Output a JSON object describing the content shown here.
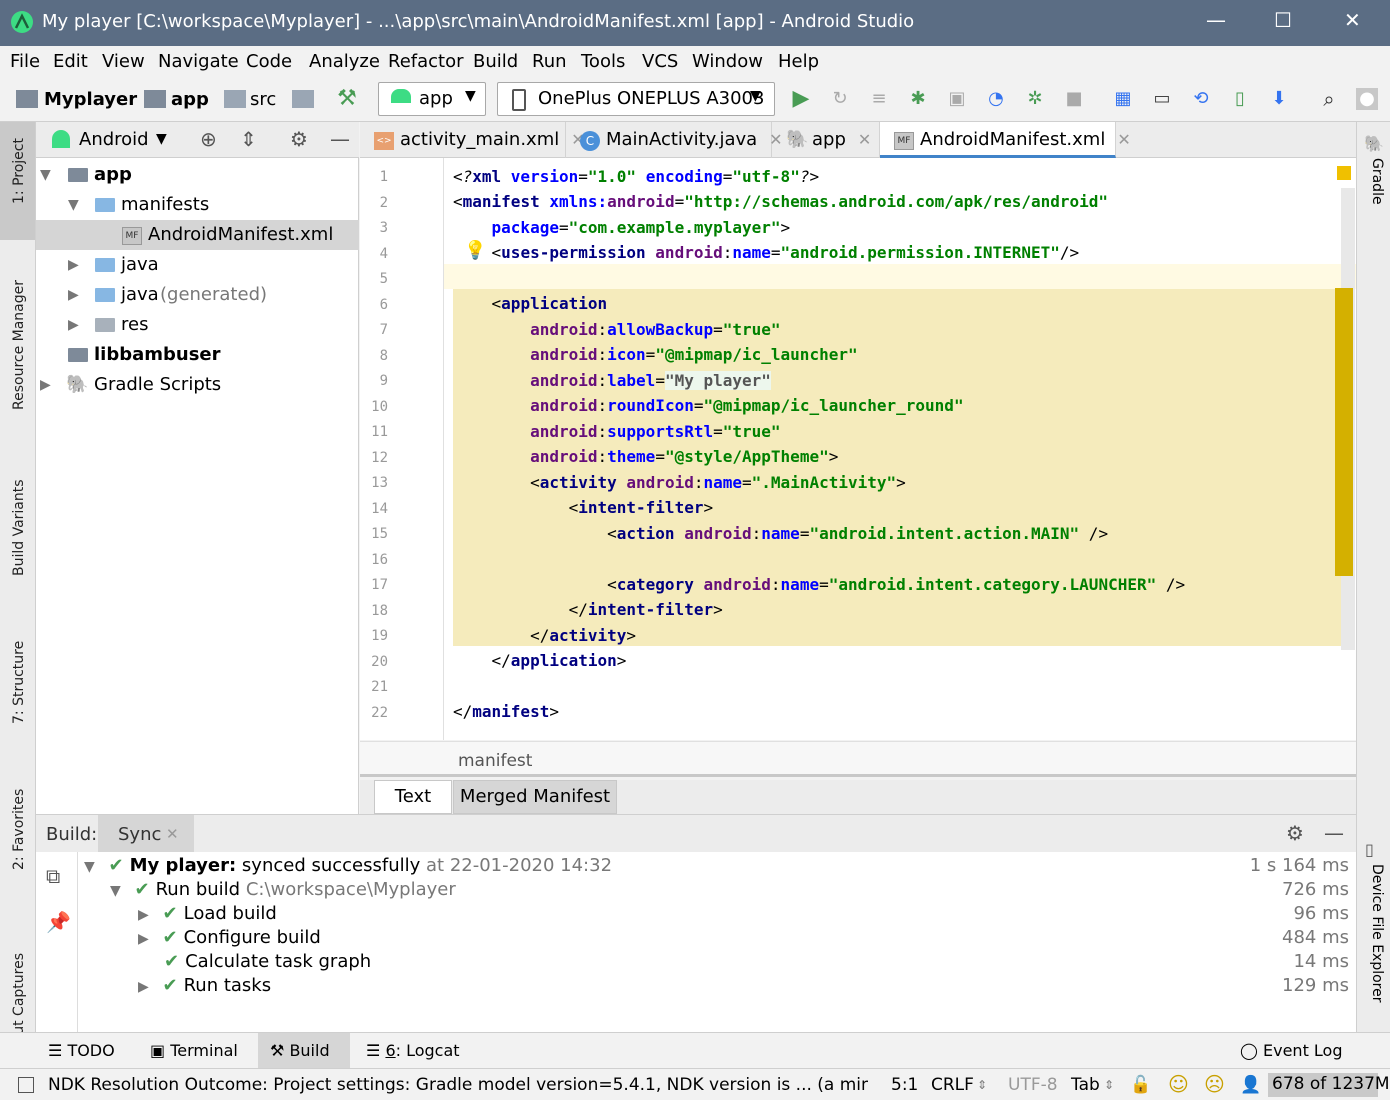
{
  "window": {
    "title": "My player [C:\\workspace\\Myplayer] - ...\\app\\src\\main\\AndroidManifest.xml [app] - Android Studio",
    "minimize": "—",
    "maximize": "☐",
    "close": "✕"
  },
  "menu": [
    "File",
    "Edit",
    "View",
    "Navigate",
    "Code",
    "Analyze",
    "Refactor",
    "Build",
    "Run",
    "Tools",
    "VCS",
    "Window",
    "Help"
  ],
  "toolbar": {
    "breadcrumb": [
      "Myplayer",
      "app",
      "src"
    ],
    "config": "app",
    "device": "OnePlus ONEPLUS A3003"
  },
  "left_tabs": [
    "1: Project",
    "Resource Manager",
    "Build Variants",
    "7: Structure",
    "2: Favorites",
    "Layout Captures"
  ],
  "right_tabs": [
    "Gradle",
    "Device File Explorer"
  ],
  "project": {
    "view": "Android",
    "tree": [
      {
        "label": "app",
        "bold": true
      },
      {
        "label": "manifests"
      },
      {
        "label": "AndroidManifest.xml"
      },
      {
        "label": "java"
      },
      {
        "label": "java",
        "suffix": "(generated)"
      },
      {
        "label": "res"
      },
      {
        "label": "libbambuser",
        "bold": true
      },
      {
        "label": "Gradle Scripts"
      }
    ]
  },
  "editor_tabs": [
    {
      "label": "activity_main.xml"
    },
    {
      "label": "MainActivity.java"
    },
    {
      "label": "app"
    },
    {
      "label": "AndroidManifest.xml",
      "active": true
    }
  ],
  "line_numbers": [
    "1",
    "2",
    "3",
    "4",
    "5",
    "6",
    "7",
    "8",
    "9",
    "10",
    "11",
    "12",
    "13",
    "14",
    "15",
    "16",
    "17",
    "18",
    "19",
    "20",
    "21",
    "22"
  ],
  "breadcrumb_bottom": "manifest",
  "editor_bottom_tabs": [
    "Text",
    "Merged Manifest"
  ],
  "build": {
    "label": "Build:",
    "tab": "Sync",
    "rows": [
      {
        "bold": "My player:",
        "text": " synced successfully",
        "gray": " at 22-01-2020 14:32",
        "time": "1 s 164 ms"
      },
      {
        "bold": "",
        "text": "Run build",
        "gray": " C:\\workspace\\Myplayer",
        "time": "726 ms"
      },
      {
        "bold": "",
        "text": "Load build",
        "gray": "",
        "time": "96 ms"
      },
      {
        "bold": "",
        "text": "Configure build",
        "gray": "",
        "time": "484 ms"
      },
      {
        "bold": "",
        "text": "Calculate task graph",
        "gray": "",
        "time": "14 ms"
      },
      {
        "bold": "",
        "text": "Run tasks",
        "gray": "",
        "time": "129 ms"
      }
    ]
  },
  "tool_windows": {
    "todo": "TODO",
    "terminal": "Terminal",
    "build": "Build",
    "logcat_num": "6",
    "logcat": ": Logcat",
    "event_log": "Event Log"
  },
  "status": {
    "message": "NDK Resolution Outcome: Project settings: Gradle model version=5.4.1, NDK version is ... (a minute ago)",
    "position": "5:1",
    "line_sep": "CRLF",
    "encoding": "UTF-8",
    "indent": "Tab",
    "memory": "678 of 1237M"
  }
}
